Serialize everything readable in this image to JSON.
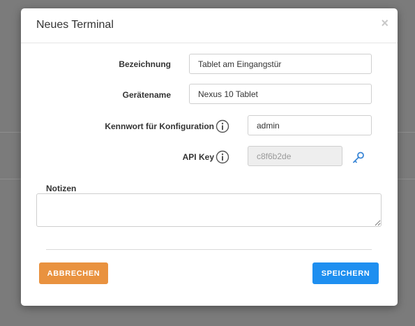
{
  "dialog": {
    "title": "Neues Terminal",
    "close_symbol": "×"
  },
  "form": {
    "name_label": "Bezeichnung",
    "name_value": "Tablet am Eingangstür",
    "device_label": "Gerätename",
    "device_value": "Nexus 10 Tablet",
    "password_label": "Kennwort für Konfiguration",
    "password_value": "admin",
    "apikey_label": "API Key",
    "apikey_value": "c8f6b2de",
    "notes_label": "Notizen",
    "notes_value": ""
  },
  "buttons": {
    "cancel_label": "ABBRECHEN",
    "save_label": "SPEICHERN"
  },
  "icons": {
    "info": "info-circle-icon",
    "key": "key-icon",
    "close": "close-icon"
  },
  "colors": {
    "cancel": "#e9923f",
    "save": "#1e8ff0",
    "key": "#3a86d6"
  }
}
